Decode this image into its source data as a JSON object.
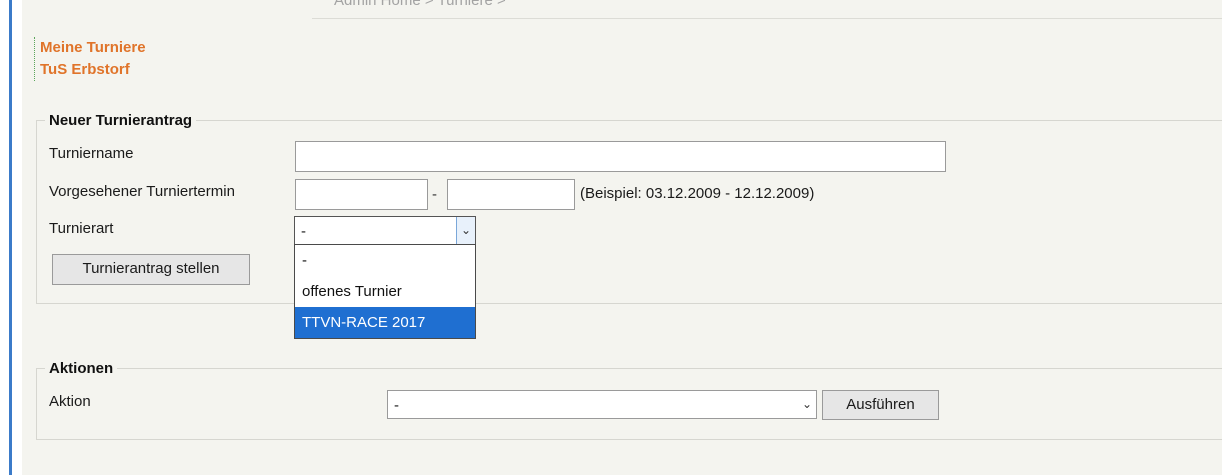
{
  "breadcrumb": "Admin Home > Turniere >",
  "titles": {
    "line1": "Meine Turniere",
    "line2": "TuS Erbstorf"
  },
  "new_request": {
    "legend": "Neuer Turnierantrag",
    "name_label": "Turniername",
    "name_value": "",
    "date_label": "Vorgesehener Turniertermin",
    "date_from_value": "",
    "date_separator": "-",
    "date_to_value": "",
    "date_hint": "(Beispiel: 03.12.2009 - 12.12.2009)",
    "type_label": "Turnierart",
    "type_selected": "-",
    "type_options": [
      "-",
      "offenes Turnier",
      "TTVN-RACE 2017"
    ],
    "type_highlighted": "TTVN-RACE 2017",
    "submit_label": "Turnierantrag stellen"
  },
  "actions": {
    "legend": "Aktionen",
    "action_label": "Aktion",
    "action_selected": "-",
    "execute_label": "Ausführen"
  },
  "colors": {
    "title_orange": "#e0742a",
    "selection_blue": "#1f6fd1",
    "page_bg": "#f4f4ef"
  }
}
